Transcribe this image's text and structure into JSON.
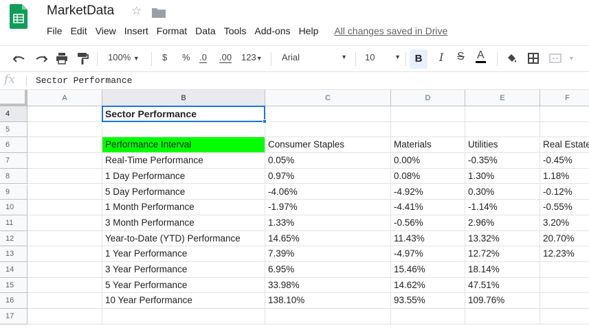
{
  "app": {
    "title": "MarketData",
    "save_status": "All changes saved in Drive",
    "accent_color": "#1a73e8",
    "logo_color": "#0f9d58"
  },
  "menu": [
    "File",
    "Edit",
    "View",
    "Insert",
    "Format",
    "Data",
    "Tools",
    "Add-ons",
    "Help"
  ],
  "toolbar": {
    "zoom": "100%",
    "currency": "$",
    "percent": "%",
    "decrease_decimal": ".0",
    "increase_decimal": ".00",
    "more_formats": "123",
    "font": "Arial",
    "font_size": "10",
    "bold": "B",
    "italic": "I",
    "strikethrough": "S",
    "text_color": "A",
    "icons": [
      "undo-icon",
      "redo-icon",
      "print-icon",
      "paint-format-icon",
      "fill-color-icon",
      "borders-icon",
      "merge-cells-icon"
    ]
  },
  "formula_bar": {
    "fx": "fx",
    "value": "Sector Performance"
  },
  "sheet": {
    "columns": [
      "A",
      "B",
      "C",
      "D",
      "E",
      "F"
    ],
    "rows": [
      {
        "num": "4",
        "cells": [
          "",
          "Sector Performance",
          "",
          "",
          "",
          ""
        ]
      },
      {
        "num": "5",
        "cells": [
          "",
          "",
          "",
          "",
          "",
          ""
        ]
      },
      {
        "num": "6",
        "cells": [
          "",
          "Performance Interval",
          "Consumer Staples",
          "Materials",
          "Utilities",
          "Real Estate"
        ]
      },
      {
        "num": "7",
        "cells": [
          "",
          "Real-Time Performance",
          "0.05%",
          "0.00%",
          "-0.35%",
          "-0.45%"
        ]
      },
      {
        "num": "8",
        "cells": [
          "",
          "1 Day Performance",
          "0.97%",
          "0.08%",
          "1.30%",
          "1.18%"
        ]
      },
      {
        "num": "9",
        "cells": [
          "",
          "5 Day Performance",
          "-4.06%",
          "-4.92%",
          "0.30%",
          "-0.12%"
        ]
      },
      {
        "num": "10",
        "cells": [
          "",
          "1 Month Performance",
          "-1.97%",
          "-4.41%",
          "-1.14%",
          "-0.55%"
        ]
      },
      {
        "num": "11",
        "cells": [
          "",
          "3 Month Performance",
          "1.33%",
          "-0.56%",
          "2.96%",
          "3.20%"
        ]
      },
      {
        "num": "12",
        "cells": [
          "",
          "Year-to-Date (YTD) Performance",
          "14.65%",
          "11.43%",
          "13.32%",
          "20.70%"
        ]
      },
      {
        "num": "13",
        "cells": [
          "",
          "1 Year Performance",
          "7.39%",
          "-4.97%",
          "12.72%",
          "12.23%"
        ]
      },
      {
        "num": "14",
        "cells": [
          "",
          "3 Year Performance",
          "6.95%",
          "15.46%",
          "18.14%",
          ""
        ]
      },
      {
        "num": "15",
        "cells": [
          "",
          "5 Year Performance",
          "33.98%",
          "14.62%",
          "47.51%",
          ""
        ]
      },
      {
        "num": "16",
        "cells": [
          "",
          "10 Year Performance",
          "138.10%",
          "93.55%",
          "109.76%",
          ""
        ]
      },
      {
        "num": "17",
        "cells": [
          "",
          "",
          "",
          "",
          "",
          ""
        ]
      }
    ],
    "selected_cell": "B4",
    "highlight_fill": "#00ff00"
  }
}
